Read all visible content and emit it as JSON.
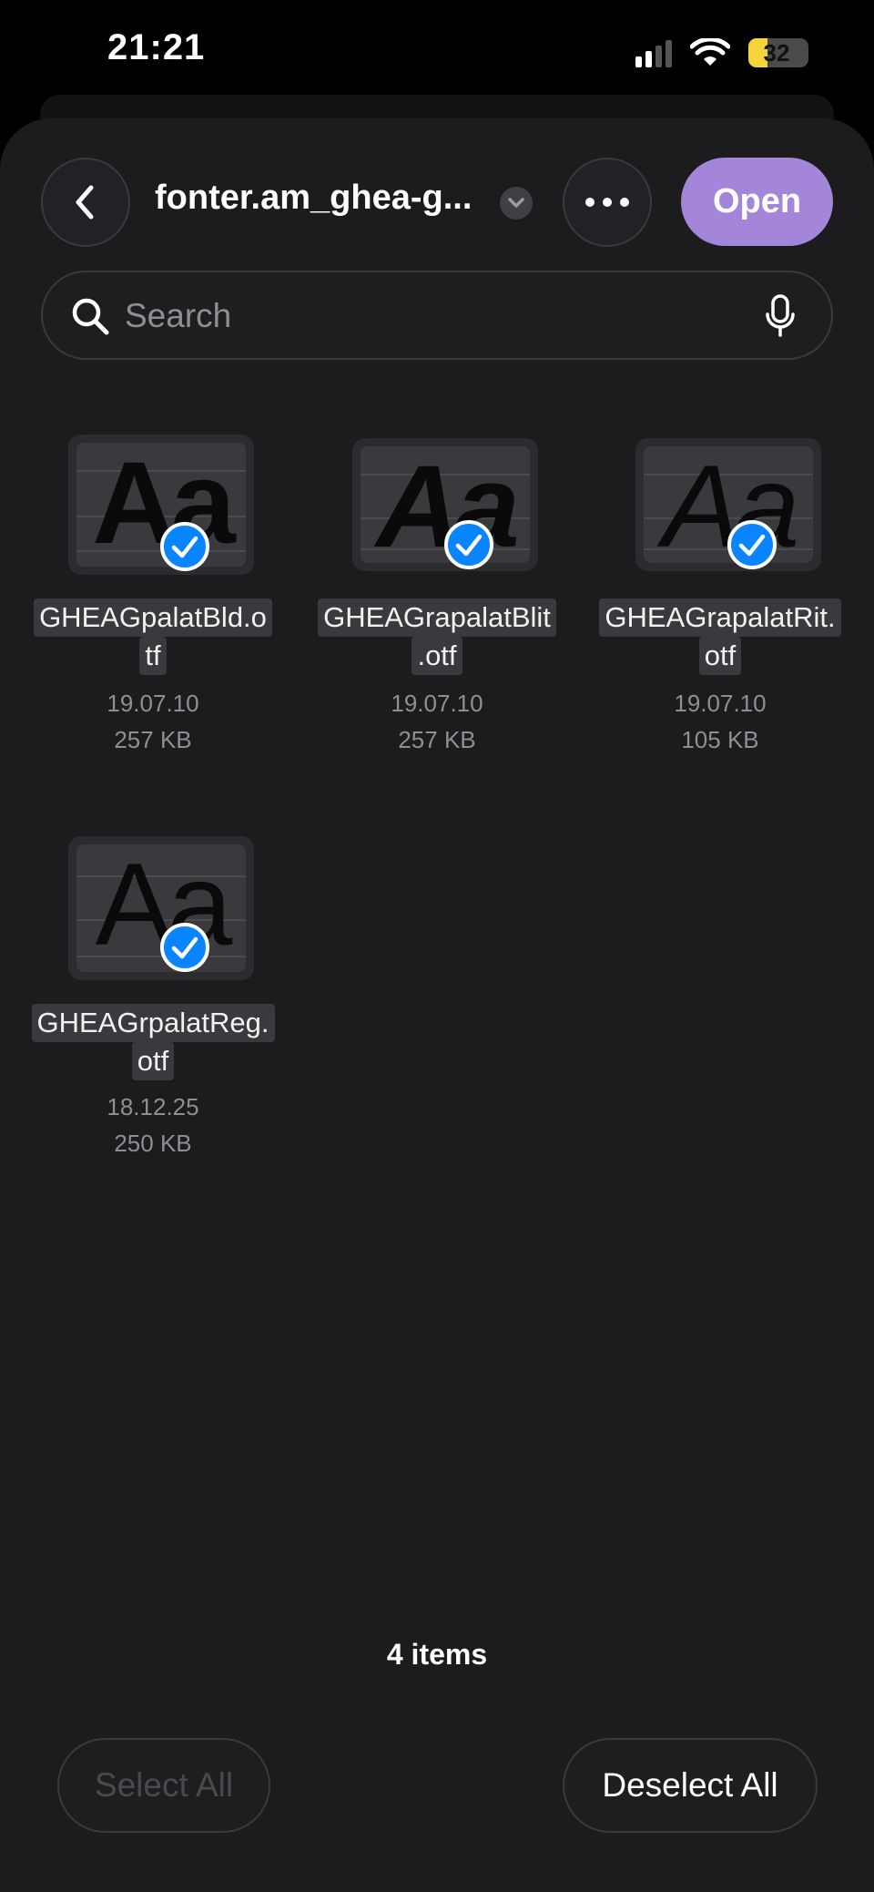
{
  "status_bar": {
    "time": "21:21",
    "battery": "32",
    "battery_color": "#f4d33b"
  },
  "header": {
    "folder_title": "fonter.am_ghea-g...",
    "open_label": "Open",
    "accent_color": "#a385d9"
  },
  "search": {
    "placeholder": "Search"
  },
  "files": [
    {
      "name_line1": "GHEAGpalatBld.o",
      "name_line2": "tf",
      "date": "19.07.10",
      "size": "257 KB",
      "glyph": "Aa",
      "selected": true
    },
    {
      "name_line1": "GHEAGrapalatBlit",
      "name_line2": ".otf",
      "date": "19.07.10",
      "size": "257 KB",
      "glyph": "Aa",
      "selected": true
    },
    {
      "name_line1": "GHEAGrapalatRit.",
      "name_line2": "otf",
      "date": "19.07.10",
      "size": "105 KB",
      "glyph": "Aa",
      "selected": true
    },
    {
      "name_line1": "GHEAGrpalatReg.",
      "name_line2": "otf",
      "date": "18.12.25",
      "size": "250 KB",
      "glyph": "Aa",
      "selected": true
    }
  ],
  "footer": {
    "items_count": "4 items",
    "select_all_label": "Select All",
    "deselect_all_label": "Deselect All"
  },
  "icons": {
    "back": "chevron-left-icon",
    "more": "ellipsis-icon",
    "search": "magnifier-icon",
    "mic": "microphone-icon",
    "check": "checkmark-circle-icon"
  }
}
